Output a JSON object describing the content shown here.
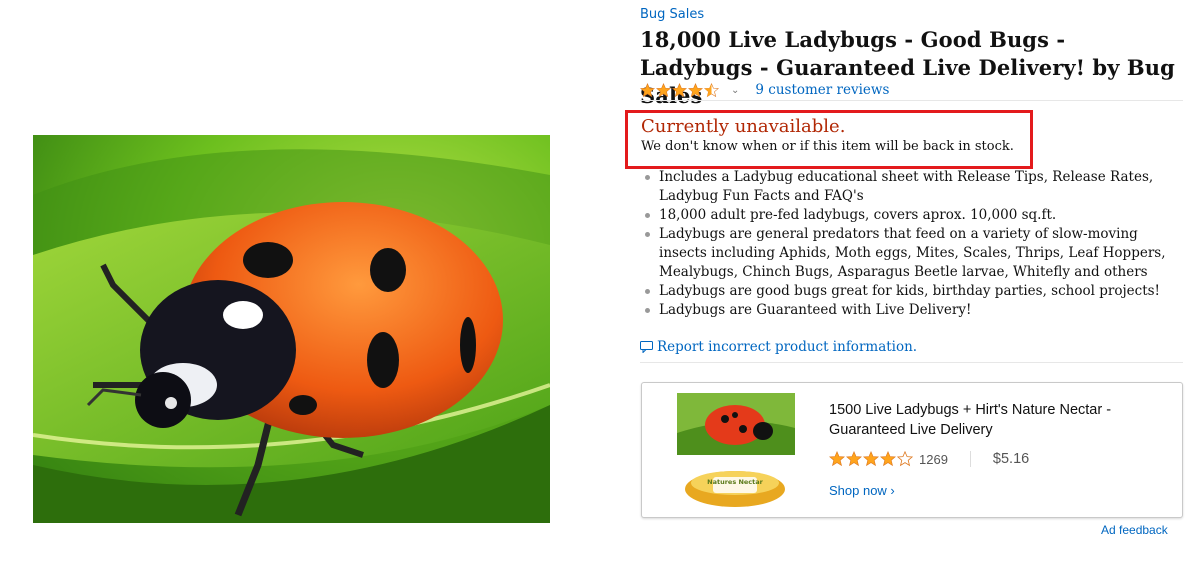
{
  "product": {
    "brand": "Bug Sales",
    "title": "18,000 Live Ladybugs - Good Bugs - Ladybugs - Guaranteed Live Delivery! by Bug Sales",
    "rating_stars": 4.5,
    "reviews_link": "9 customer reviews",
    "image_alt_icon": "ladybug-photo"
  },
  "availability": {
    "title": "Currently unavailable.",
    "subtitle": "We don't know when or if this item will be back in stock.",
    "highlight_color": "#e31a1c"
  },
  "bullets": [
    "Includes a Ladybug educational sheet with Release Tips, Release Rates, Ladybug Fun Facts and FAQ's",
    "18,000 adult pre-fed ladybugs, covers aprox. 10,000 sq.ft.",
    "Ladybugs are general predators that feed on a variety of slow-moving insects including Aphids, Moth eggs, Mites, Scales, Thrips, Leaf Hoppers, Mealybugs, Chinch Bugs, Asparagus Beetle larvae, Whitefly and others",
    "Ladybugs are good bugs great for kids, birthday parties, school projects!",
    "Ladybugs are Guaranteed with Live Delivery!"
  ],
  "report_link": "Report incorrect product information.",
  "ad": {
    "title": "1500 Live Ladybugs + Hirt's Nature Nectar - Guaranteed Live Delivery",
    "rating_stars": 4,
    "rating_count": "1269",
    "price": "$5.16",
    "shop_link": "Shop now ›",
    "thumb_label": "Natures Nectar"
  },
  "ad_feedback": "Ad feedback",
  "colors": {
    "link": "#0066c0",
    "star": "#ffa41c",
    "unavailable": "#b12704"
  }
}
